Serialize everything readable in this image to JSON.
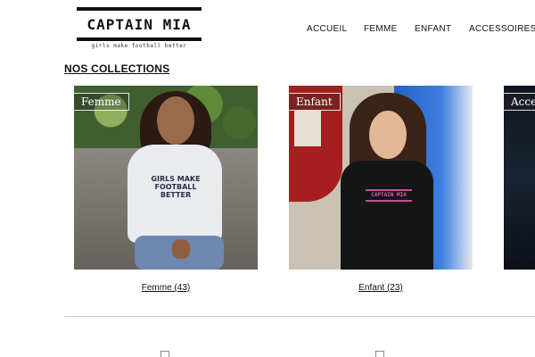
{
  "brand": {
    "name": "CAPTAIN MIA",
    "tagline": "girls make football better"
  },
  "nav": {
    "items": [
      {
        "label": "ACCUEIL"
      },
      {
        "label": "FEMME"
      },
      {
        "label": "ENFANT"
      },
      {
        "label": "ACCESSOIRES"
      }
    ]
  },
  "collections": {
    "title": "NOS COLLECTIONS",
    "cards": [
      {
        "tag": "Femme",
        "caption": "Femme (43)",
        "shirt_text": "GIRLS MAKE FOOTBALL BETTER"
      },
      {
        "tag": "Enfant",
        "caption": "Enfant (23)",
        "shirt_text": "CAPTAIN MIA"
      },
      {
        "tag": "Access"
      }
    ]
  },
  "colors": {
    "text": "#111111",
    "divider": "#cfcfcf",
    "background": "#ffffff"
  }
}
